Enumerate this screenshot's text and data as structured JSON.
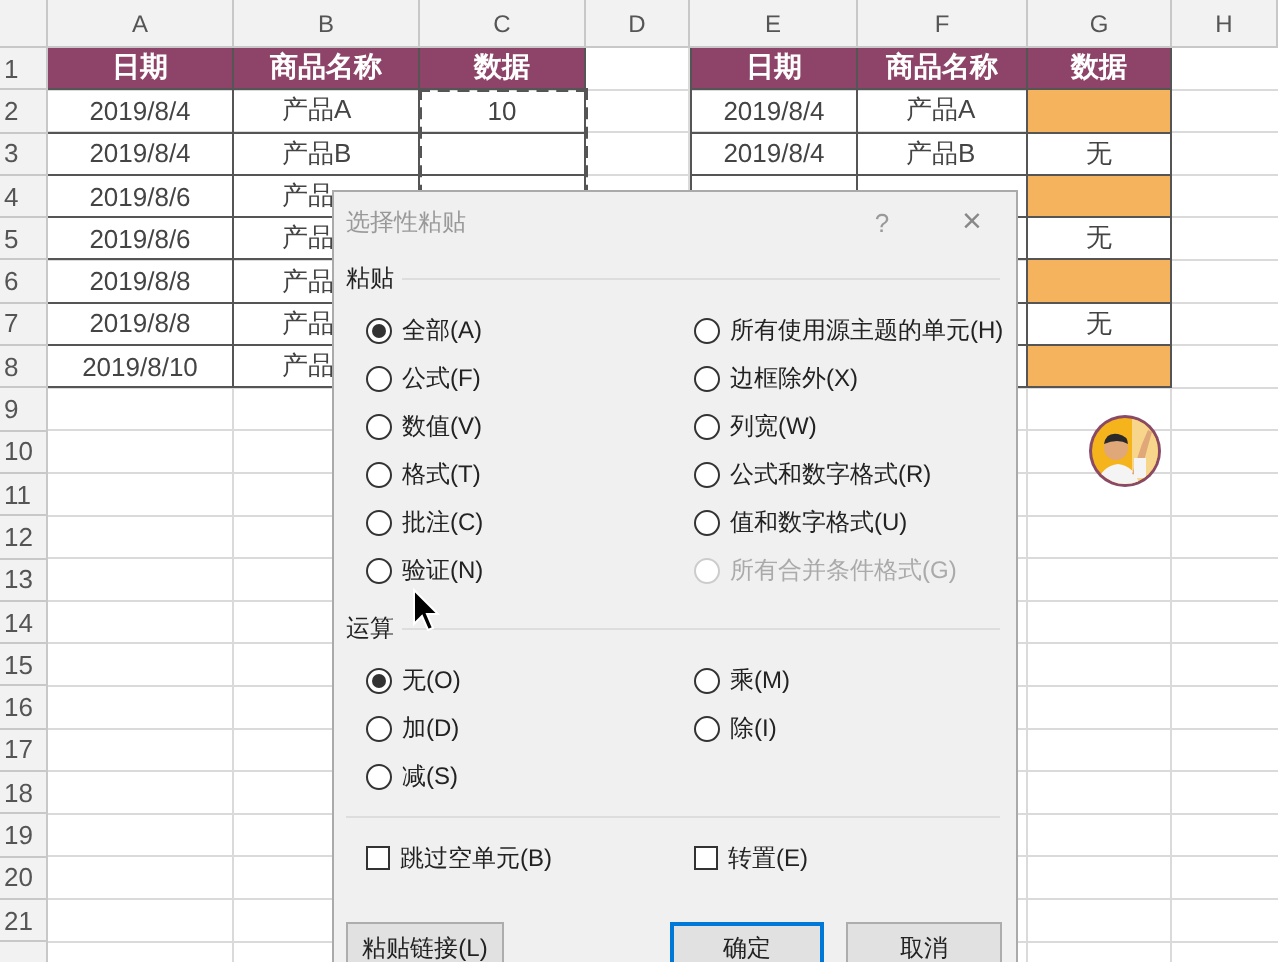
{
  "column_letters": [
    "A",
    "B",
    "C",
    "D",
    "E",
    "F",
    "G",
    "H"
  ],
  "row_numbers": [
    "1",
    "2",
    "3",
    "4",
    "5",
    "6",
    "7",
    "8",
    "9",
    "10",
    "11",
    "12",
    "13",
    "14",
    "15",
    "16",
    "17",
    "18",
    "19",
    "20",
    "21"
  ],
  "left_table": {
    "header": [
      "日期",
      "商品名称",
      "数据"
    ],
    "data_copied": true,
    "rows": [
      {
        "date": "2019/8/4",
        "product": "产品A",
        "data": "10"
      },
      {
        "date": "2019/8/4",
        "product": "产品B"
      },
      {
        "date": "2019/8/6",
        "product": "产品"
      },
      {
        "date": "2019/8/6",
        "product": "产品"
      },
      {
        "date": "2019/8/8",
        "product": "产品"
      },
      {
        "date": "2019/8/8",
        "product": "产品"
      },
      {
        "date": "2019/8/10",
        "product": "产品"
      }
    ]
  },
  "right_table": {
    "header": [
      "日期",
      "商品名称",
      "数据"
    ],
    "rows": [
      {
        "date": "2019/8/4",
        "product": "产品A",
        "highlighted": true
      },
      {
        "date": "2019/8/4",
        "product": "产品B",
        "data": "无",
        "highlighted": false
      },
      {
        "highlighted": true
      },
      {
        "data": "无",
        "highlighted": false
      },
      {
        "highlighted": true
      },
      {
        "data": "无",
        "highlighted": false
      },
      {
        "highlighted": true
      }
    ]
  },
  "dialog": {
    "title": "选择性粘贴",
    "help": "?",
    "close": "×",
    "paste_section": "粘贴",
    "paste_options": [
      {
        "label": "全部(A)",
        "selected": true,
        "disabled": false
      },
      {
        "label": "公式(F)",
        "selected": false,
        "disabled": false
      },
      {
        "label": "数值(V)",
        "selected": false,
        "disabled": false
      },
      {
        "label": "格式(T)",
        "selected": false,
        "disabled": false
      },
      {
        "label": "批注(C)",
        "selected": false,
        "disabled": false
      },
      {
        "label": "验证(N)",
        "selected": false,
        "disabled": false
      },
      {
        "label": "所有使用源主题的单元(H)",
        "selected": false,
        "disabled": false
      },
      {
        "label": "边框除外(X)",
        "selected": false,
        "disabled": false
      },
      {
        "label": "列宽(W)",
        "selected": false,
        "disabled": false
      },
      {
        "label": "公式和数字格式(R)",
        "selected": false,
        "disabled": false
      },
      {
        "label": "值和数字格式(U)",
        "selected": false,
        "disabled": false
      },
      {
        "label": "所有合并条件格式(G)",
        "selected": false,
        "disabled": true
      }
    ],
    "operation_section": "运算",
    "operation_options": [
      {
        "label": "无(O)",
        "selected": true,
        "disabled": false
      },
      {
        "label": "加(D)",
        "selected": false,
        "disabled": false
      },
      {
        "label": "减(S)",
        "selected": false,
        "disabled": false
      },
      {
        "label": "乘(M)",
        "selected": false,
        "disabled": false
      },
      {
        "label": "除(I)",
        "selected": false,
        "disabled": false
      }
    ],
    "checkboxes": [
      {
        "label": "跳过空单元(B)",
        "checked": false
      },
      {
        "label": "转置(E)",
        "checked": false
      }
    ],
    "buttons": [
      {
        "label": "粘贴链接(L)",
        "default": false
      },
      {
        "label": "确定",
        "default": true
      },
      {
        "label": "取消",
        "default": false
      }
    ]
  }
}
